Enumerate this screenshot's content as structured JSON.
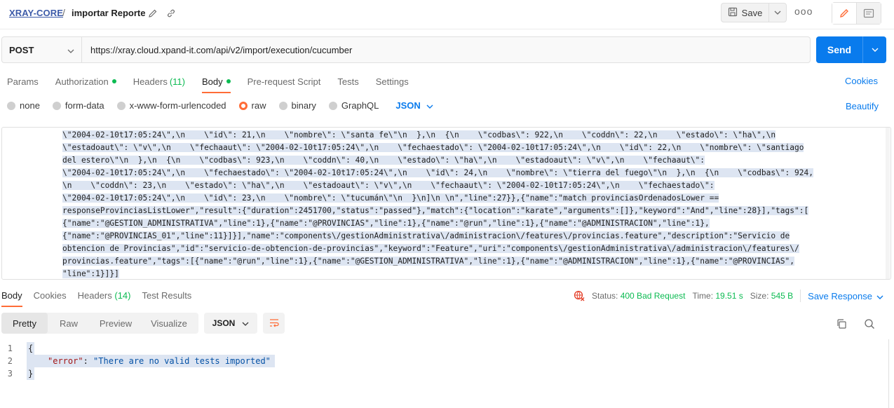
{
  "header": {
    "collection": "XRAY-CORE",
    "separator": "/",
    "request_name": "importar Reporte",
    "save_label": "Save",
    "more_label": "ooo"
  },
  "request": {
    "method": "POST",
    "url": "https://xray.cloud.xpand-it.com/api/v2/import/execution/cucumber",
    "send_label": "Send"
  },
  "request_tabs": [
    {
      "label": "Params"
    },
    {
      "label": "Authorization"
    },
    {
      "label": "Headers",
      "count": "(11)"
    },
    {
      "label": "Body"
    },
    {
      "label": "Pre-request Script"
    },
    {
      "label": "Tests"
    },
    {
      "label": "Settings"
    }
  ],
  "cookies_label": "Cookies",
  "body_types": [
    "none",
    "form-data",
    "x-www-form-urlencoded",
    "raw",
    "binary",
    "GraphQL"
  ],
  "body_format": "JSON",
  "beautify_label": "Beautify",
  "raw_body_lines": [
    "\\\"2004-02-10t17:05:24\\\",\\n    \\\"id\\\": 21,\\n    \\\"nombre\\\": \\\"santa fe\\\"\\n  },\\n  {\\n    \\\"codbas\\\": 922,\\n    \\\"coddn\\\": 22,\\n    \\\"estado\\\": \\\"ha\\\",\\n",
    "\\\"estadoaut\\\": \\\"v\\\",\\n    \\\"fechaaut\\\": \\\"2004-02-10t17:05:24\\\",\\n    \\\"fechaestado\\\": \\\"2004-02-10t17:05:24\\\",\\n    \\\"id\\\": 22,\\n    \\\"nombre\\\": \\\"santiago",
    "del estero\\\"\\n  },\\n  {\\n    \\\"codbas\\\": 923,\\n    \\\"coddn\\\": 40,\\n    \\\"estado\\\": \\\"ha\\\",\\n    \\\"estadoaut\\\": \\\"v\\\",\\n    \\\"fechaaut\\\":",
    "\\\"2004-02-10t17:05:24\\\",\\n    \\\"fechaestado\\\": \\\"2004-02-10t17:05:24\\\",\\n    \\\"id\\\": 24,\\n    \\\"nombre\\\": \\\"tierra del fuego\\\"\\n  },\\n  {\\n    \\\"codbas\\\": 924,",
    "\\n    \\\"coddn\\\": 23,\\n    \\\"estado\\\": \\\"ha\\\",\\n    \\\"estadoaut\\\": \\\"v\\\",\\n    \\\"fechaaut\\\": \\\"2004-02-10t17:05:24\\\",\\n    \\\"fechaestado\\\":",
    "\\\"2004-02-10t17:05:24\\\",\\n    \\\"id\\\": 23,\\n    \\\"nombre\\\": \\\"tucumán\\\"\\n  }\\n]\\n \\n\",\"line\":27}},{\"name\":\"match provinciasOrdenadosLower ==",
    "responseProvinciasListLower\",\"result\":{\"duration\":2451700,\"status\":\"passed\"},\"match\":{\"location\":\"karate\",\"arguments\":[]},\"keyword\":\"And\",\"line\":28}],\"tags\":[",
    "{\"name\":\"@GESTION_ADMINISTRATIVA\",\"line\":1},{\"name\":\"@PROVINCIAS\",\"line\":1},{\"name\":\"@run\",\"line\":1},{\"name\":\"@ADMINISTRACION\",\"line\":1},",
    "{\"name\":\"@PROVINCIAS_01\",\"line\":11}]}],\"name\":\"components\\/gestionAdministrativa\\/administracion\\/features\\/provincias.feature\",\"description\":\"Servicio de",
    "obtencion de Provincias\",\"id\":\"servicio-de-obtencion-de-provincias\",\"keyword\":\"Feature\",\"uri\":\"components\\/gestionAdministrativa\\/administracion\\/features\\/",
    "provincias.feature\",\"tags\":[{\"name\":\"@run\",\"line\":1},{\"name\":\"@GESTION_ADMINISTRATIVA\",\"line\":1},{\"name\":\"@ADMINISTRACION\",\"line\":1},{\"name\":\"@PROVINCIAS\",",
    "\"line\":1}]}]"
  ],
  "response": {
    "tabs": [
      {
        "label": "Body"
      },
      {
        "label": "Cookies"
      },
      {
        "label": "Headers",
        "count": "(14)"
      },
      {
        "label": "Test Results"
      }
    ],
    "status_label": "Status:",
    "status_value": "400 Bad Request",
    "time_label": "Time:",
    "time_value": "19.51 s",
    "size_label": "Size:",
    "size_value": "545 B",
    "save_response_label": "Save Response",
    "view_modes": [
      "Pretty",
      "Raw",
      "Preview",
      "Visualize"
    ],
    "format": "JSON",
    "lines": [
      {
        "num": "1",
        "text": "{"
      },
      {
        "num": "2",
        "key": "\"error\"",
        "colon": ": ",
        "value": "\"There are no valid tests imported\""
      },
      {
        "num": "3",
        "text": "}"
      }
    ]
  },
  "colors": {
    "accent": "#ff6c37",
    "primary": "#097bed",
    "success": "#0cbb52",
    "error": "#e4402a"
  }
}
